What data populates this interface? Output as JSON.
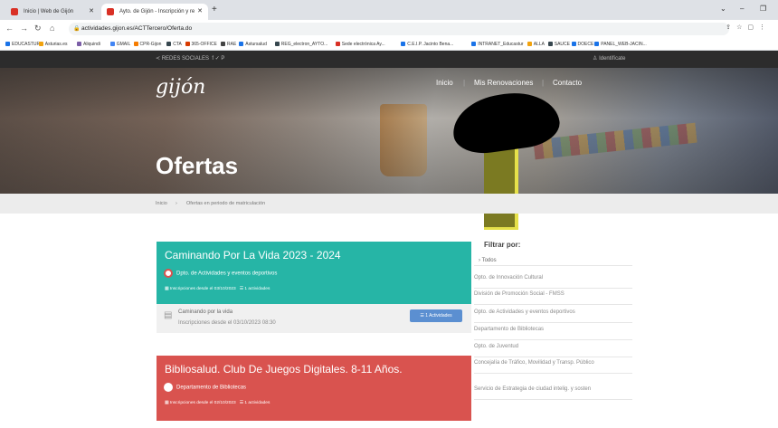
{
  "browser": {
    "tabs": [
      {
        "title": "Inicio | Web de Gijón",
        "active": false,
        "favicon_color": "#d93025"
      },
      {
        "title": "Ayto. de Gijón - Inscripción y re",
        "active": true,
        "favicon_color": "#d93025"
      }
    ],
    "url": "actividades.gijon.es/ACTTercero/Oferta.do",
    "bookmarks": [
      {
        "label": "EDUCASTUR",
        "color": "#1a73e8"
      },
      {
        "label": "Asturias.es",
        "color": "#f1a20e"
      },
      {
        "label": "Aliquindi",
        "color": "#7b5ea7"
      },
      {
        "label": "GMAIL",
        "color": "#4285f4"
      },
      {
        "label": "CPR-Gijon",
        "color": "#f57c00"
      },
      {
        "label": "CTA",
        "color": "#37474f"
      },
      {
        "label": "365-OFFICE",
        "color": "#d83b01"
      },
      {
        "label": "RAE",
        "color": "#444444"
      },
      {
        "label": "Astursalud",
        "color": "#1a73e8"
      },
      {
        "label": "REG_electron_AYTO...",
        "color": "#37474f"
      },
      {
        "label": "Sede electrónica Ay...",
        "color": "#d93025"
      },
      {
        "label": "C.E.I.P. Jacinto Bena...",
        "color": "#1a73e8"
      },
      {
        "label": "INTRANET_Educastur",
        "color": "#1a73e8"
      },
      {
        "label": "ALLA",
        "color": "#f1a20e"
      },
      {
        "label": "SAUCE",
        "color": "#37474f"
      },
      {
        "label": "DOECE",
        "color": "#1a73e8"
      },
      {
        "label": "PANEL_WEB-JACIN...",
        "color": "#1a73e8"
      }
    ]
  },
  "site": {
    "social_label": "REDES SOCIALES",
    "social_icons": "f  ✓  P",
    "login_label": "Identifícate",
    "logo": "gijón",
    "nav": [
      "Inicio",
      "Mis Renovaciones",
      "Contacto"
    ],
    "hero_title": "Ofertas",
    "breadcrumb": [
      "Inicio",
      "Ofertas en periodo de matriculación"
    ]
  },
  "offers": [
    {
      "title": "Caminando Por La Vida 2023 - 2024",
      "department": "Dpto. de Actividades y eventos deportivos",
      "meta_date": "Inscripciones desde el 03/10/2023",
      "meta_count": "1 actividades",
      "activity_name": "Caminando por la vida",
      "activity_date": "Inscripciones desde el 03/10/2023 08:30",
      "button_label": "1 Actividades",
      "color": "#26b5a6"
    },
    {
      "title": "Bibliosalud. Club De Juegos Digitales. 8-11 Años.",
      "department": "Departamento de Bibliotecas",
      "meta_date": "Inscripciones desde el 02/10/2023",
      "meta_count": "1 actividades",
      "color": "#d9534f"
    }
  ],
  "filter": {
    "title": "Filtrar por:",
    "items": [
      "Todos",
      "Opto. de Innovación Cultural",
      "División de Promoción Social - FMSS",
      "Opto. de Actividades y eventos deportivos",
      "Departamento de Bibliotecas",
      "Opto. de Juventud",
      "Concejalía de Tráfico, Movilidad y Transp. Público",
      "Servicio de Estrategia de ciudad intelig. y sosten"
    ]
  }
}
